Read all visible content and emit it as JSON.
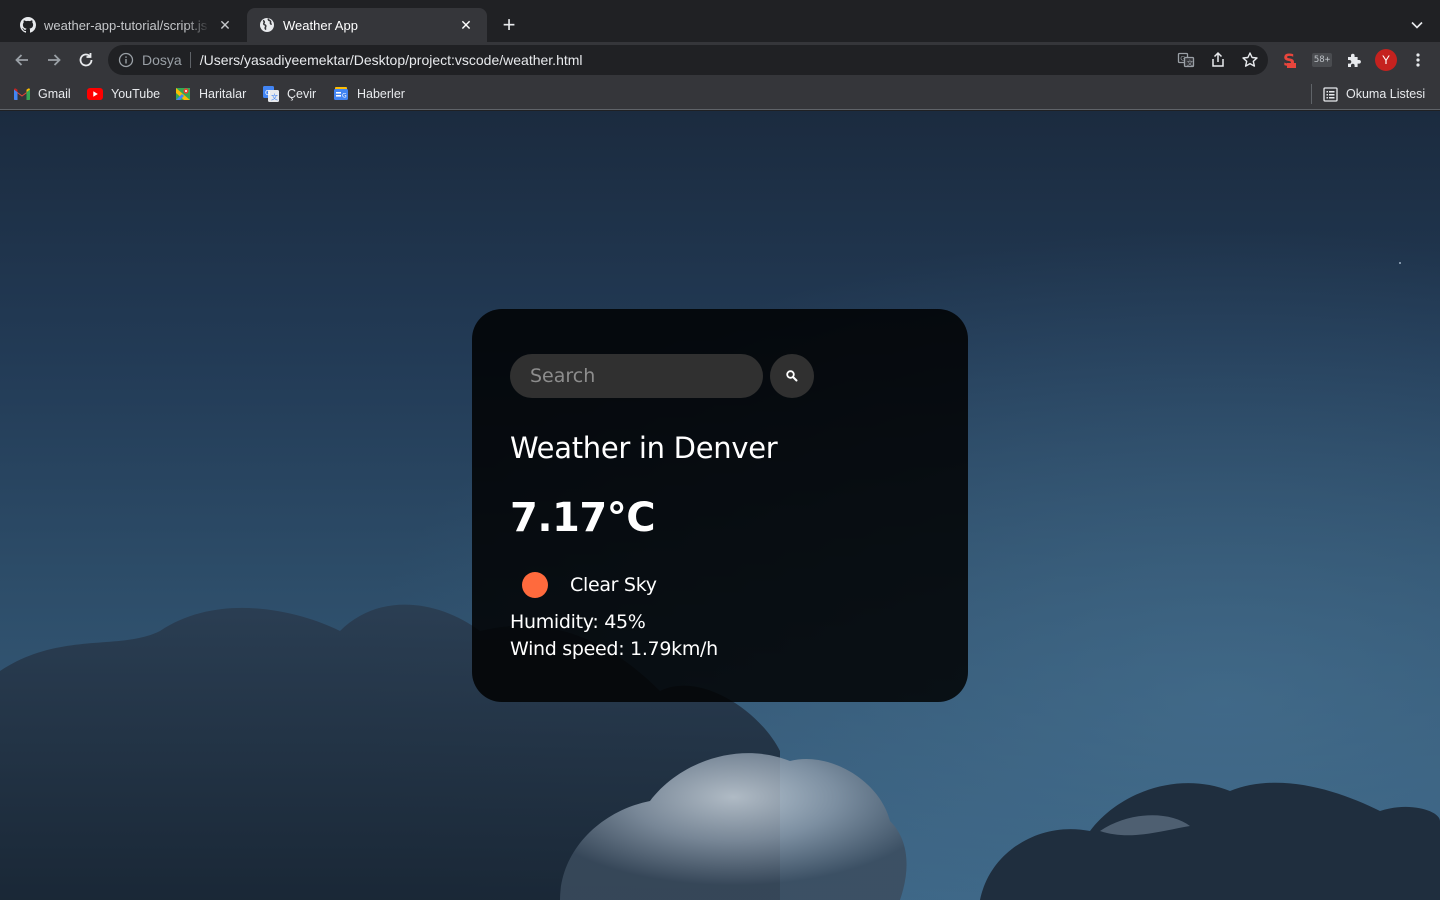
{
  "browser": {
    "tabs": [
      {
        "title": "weather-app-tutorial/script.js at",
        "icon": "github-icon",
        "active": false
      },
      {
        "title": "Weather App",
        "icon": "globe-icon",
        "active": true
      }
    ],
    "address": {
      "scheme_label": "Dosya",
      "url": "/Users/yasadiyeemektar/Desktop/project:vscode/weather.html"
    },
    "extensions": {
      "counter_badge": "58+",
      "profile_initial": "Y"
    },
    "bookmarks": [
      {
        "label": "Gmail",
        "icon": "gmail-icon"
      },
      {
        "label": "YouTube",
        "icon": "youtube-icon"
      },
      {
        "label": "Haritalar",
        "icon": "maps-icon"
      },
      {
        "label": "Çevir",
        "icon": "translate-icon"
      },
      {
        "label": "Haberler",
        "icon": "news-icon"
      }
    ],
    "reading_list": "Okuma Listesi"
  },
  "weather": {
    "search_placeholder": "Search",
    "city": "Weather in Denver",
    "temp": "7.17°C",
    "description": "Clear Sky",
    "humidity": "Humidity: 45%",
    "wind": "Wind speed: 1.79km/h",
    "icon_color": "#ff6a3d"
  },
  "colors": {
    "accent": "#ff6a3d",
    "card_bg": "#0a0b0d",
    "chrome_dark": "#202124",
    "chrome_toolbar": "#35363a"
  }
}
